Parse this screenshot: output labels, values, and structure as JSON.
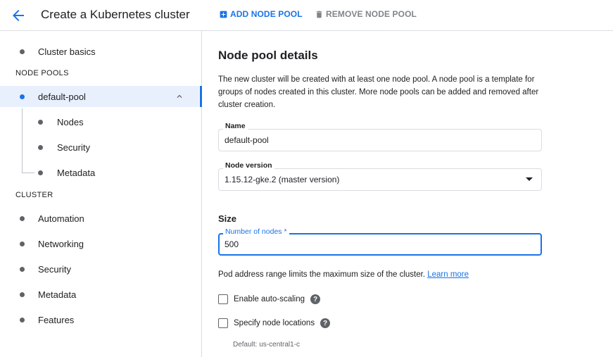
{
  "header": {
    "title": "Create a Kubernetes cluster",
    "add_node_pool": "ADD NODE POOL",
    "remove_node_pool": "REMOVE NODE POOL"
  },
  "sidebar": {
    "cluster_basics": "Cluster basics",
    "node_pools_section": "NODE POOLS",
    "default_pool": "default-pool",
    "pool_children": [
      "Nodes",
      "Security",
      "Metadata"
    ],
    "cluster_section": "CLUSTER",
    "cluster_items": [
      "Automation",
      "Networking",
      "Security",
      "Metadata",
      "Features"
    ]
  },
  "main": {
    "title": "Node pool details",
    "description": "The new cluster will be created with at least one node pool. A node pool is a template for groups of nodes created in this cluster. More node pools can be added and removed after cluster creation.",
    "name_label": "Name",
    "name_value": "default-pool",
    "node_version_label": "Node version",
    "node_version_value": "1.15.12-gke.2 (master version)",
    "size_title": "Size",
    "num_nodes_label": "Number of nodes *",
    "num_nodes_value": "500",
    "pod_hint": "Pod address range limits the maximum size of the cluster.",
    "learn_more": "Learn more",
    "autoscaling_label": "Enable auto-scaling",
    "node_locations_label": "Specify node locations",
    "default_location": "Default: us-central1-c",
    "help_glyph": "?"
  },
  "colors": {
    "accent": "#1a73e8",
    "active_bg": "#e8f0fe",
    "border": "#dadce0",
    "muted": "#5f6368"
  },
  "icons": {
    "back": "arrow-back-icon",
    "add": "add-box-icon",
    "remove": "trash-icon",
    "collapse": "chevron-up-icon",
    "help": "help-icon",
    "dropdown": "dropdown-arrow-icon"
  }
}
